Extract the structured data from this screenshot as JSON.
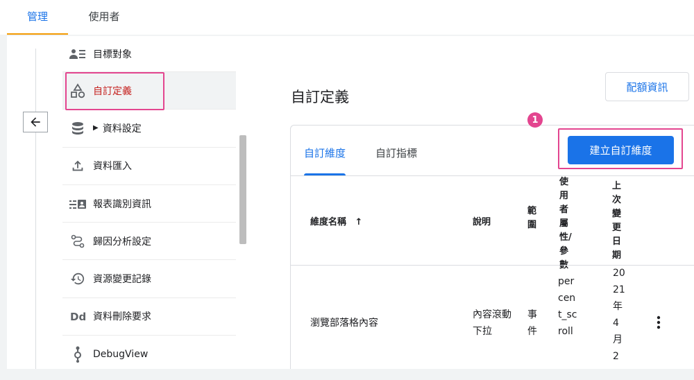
{
  "top_tabs": [
    {
      "label": "管理"
    },
    {
      "label": "使用者"
    }
  ],
  "sidebar": {
    "items": [
      {
        "label": "目標對象",
        "icon": "audience-icon"
      },
      {
        "label": "自訂定義",
        "icon": "shapes-icon"
      },
      {
        "label": "資料設定",
        "icon": "database-icon"
      },
      {
        "label": "資料匯入",
        "icon": "upload-icon"
      },
      {
        "label": "報表識別資訊",
        "icon": "reporting-identity-icon"
      },
      {
        "label": "歸因分析設定",
        "icon": "attribution-icon"
      },
      {
        "label": "資源變更記錄",
        "icon": "history-icon"
      },
      {
        "label": "資料刪除要求",
        "icon": "data-deletion-icon"
      },
      {
        "label": "DebugView",
        "icon": "debug-icon"
      }
    ],
    "back_icon": "arrow-left-icon"
  },
  "main": {
    "title": "自訂定義",
    "quota_button": "配額資訊",
    "tabs": [
      {
        "label": "自訂維度"
      },
      {
        "label": "自訂指標"
      }
    ],
    "create_button": "建立自訂維度",
    "step_badge": "1",
    "table": {
      "headers": {
        "name": "維度名稱",
        "sort_indicator": "↑",
        "description": "說明",
        "scope": "範圍",
        "param": "使用者屬性/參數",
        "last_changed": "上次變更日期"
      },
      "rows": [
        {
          "name": "瀏覽部落格內容",
          "description": "內容滾動下拉",
          "scope": "事件",
          "param": "percent_scroll",
          "last_changed": "2021年4月2"
        }
      ]
    }
  },
  "colors": {
    "accent": "#1a73e8",
    "highlight": "#e3458f",
    "active_tab_underline": "#f29900",
    "active_nav_text": "#c5221f"
  }
}
